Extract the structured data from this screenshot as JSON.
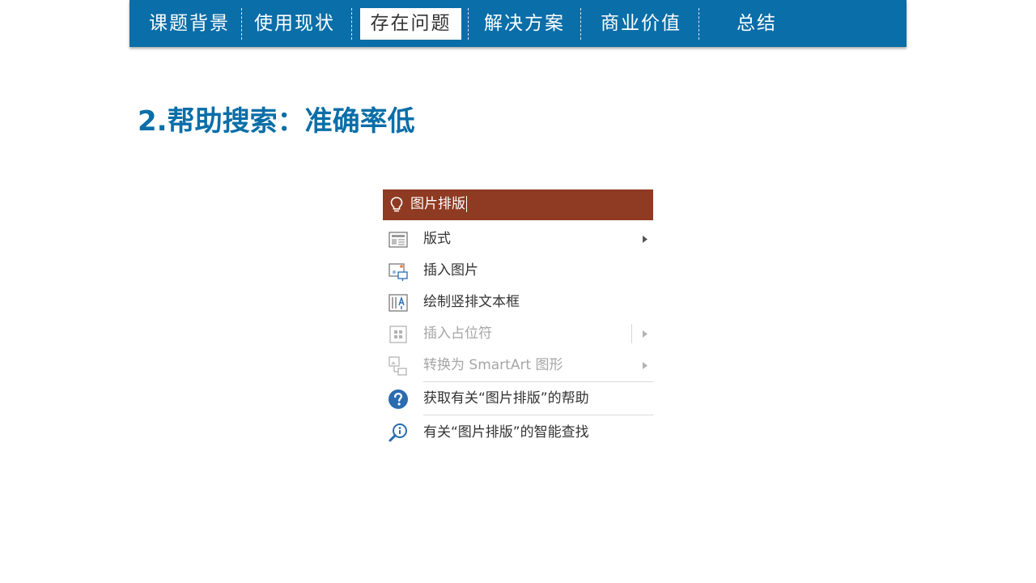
{
  "nav": {
    "items": [
      {
        "label": "课题背景",
        "active": false
      },
      {
        "label": "使用现状",
        "active": false
      },
      {
        "label": "存在问题",
        "active": true
      },
      {
        "label": "解决方案",
        "active": false
      },
      {
        "label": "商业价值",
        "active": false
      },
      {
        "label": "总结",
        "active": false
      }
    ]
  },
  "page": {
    "title": "2.帮助搜索：准确率低"
  },
  "search": {
    "query": "图片排版",
    "icon": "lightbulb-icon",
    "bar_color": "#8f3a22"
  },
  "menu": {
    "items": [
      {
        "label": "版式",
        "icon": "layout-icon",
        "has_submenu": true,
        "disabled": false
      },
      {
        "label": "插入图片",
        "icon": "insert-picture-icon",
        "has_submenu": false,
        "disabled": false
      },
      {
        "label": "绘制竖排文本框",
        "icon": "vertical-textbox-icon",
        "has_submenu": false,
        "disabled": false
      },
      {
        "label": "插入占位符",
        "icon": "placeholder-icon",
        "has_submenu": true,
        "disabled": true
      },
      {
        "label": "转换为 SmartArt 图形",
        "icon": "smartart-icon",
        "has_submenu": true,
        "disabled": true
      },
      {
        "label": "获取有关“图片排版”的帮助",
        "icon": "help-icon",
        "has_submenu": false,
        "disabled": false
      },
      {
        "label": "有关“图片排版”的智能查找",
        "icon": "smart-lookup-icon",
        "has_submenu": false,
        "disabled": false
      }
    ]
  },
  "colors": {
    "brand": "#0a6ea8",
    "help_blue": "#2b6cb0"
  }
}
